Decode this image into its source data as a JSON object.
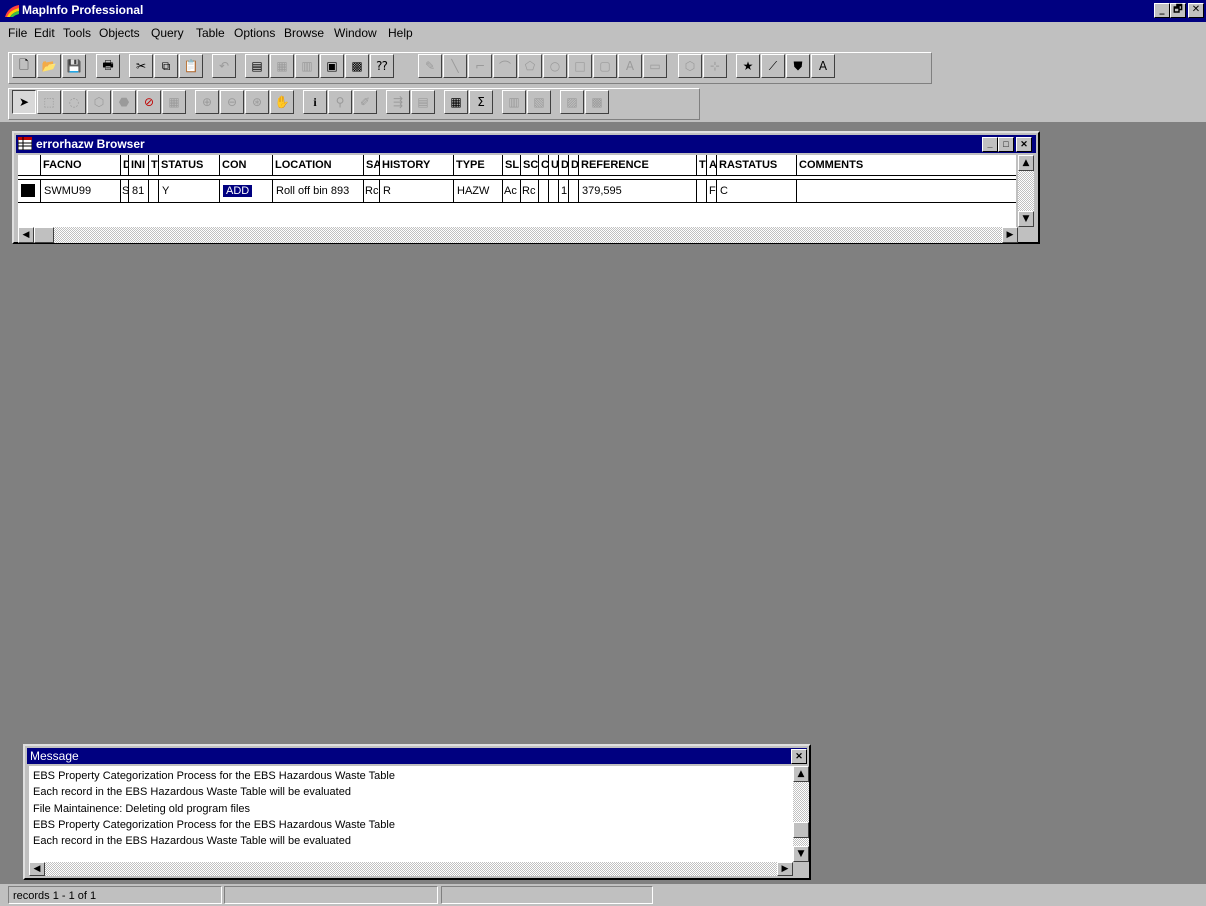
{
  "app": {
    "title": "MapInfo Professional"
  },
  "window_controls": [
    "_",
    "🗗",
    "✕"
  ],
  "menu": [
    "File",
    "Edit",
    "Tools",
    "Objects",
    "Query",
    "Table",
    "Options",
    "Browse",
    "Window",
    "Help"
  ],
  "browser": {
    "title": "errorhazw Browser",
    "columns": [
      "FACNO",
      "D",
      "INI",
      "T",
      "STATUS",
      "CON",
      "LOCATION",
      "SA",
      "HISTORY",
      "TYPE",
      "SL",
      "SC",
      "C",
      "U",
      "D",
      "D",
      "REFERENCE",
      "T",
      "A",
      "RASTATUS",
      "COMMENTS"
    ],
    "row": [
      "SWMU99",
      "S",
      "81",
      "",
      "Y",
      "ADD",
      "Roll off bin 893",
      "Rc",
      "R",
      "HAZW",
      "Ac",
      "Rc",
      "",
      "",
      "1",
      "",
      "379,595",
      "",
      "F",
      "C",
      ""
    ],
    "selected_cell": "ADD"
  },
  "message": {
    "title": "Message",
    "lines": [
      "EBS Property Categorization Process for the EBS Hazardous Waste Table",
      "Each record in the EBS Hazardous Waste Table will be evaluated",
      "File Maintainence: Deleting old program files",
      "EBS Property Categorization Process for the EBS Hazardous Waste Table",
      "Each record in the EBS Hazardous Waste Table will be evaluated"
    ]
  },
  "status": {
    "records": "records 1 - 1 of 1"
  },
  "colors": {
    "title_bar": "#000080",
    "face": "#c0c0c0",
    "desktop": "#808080"
  }
}
